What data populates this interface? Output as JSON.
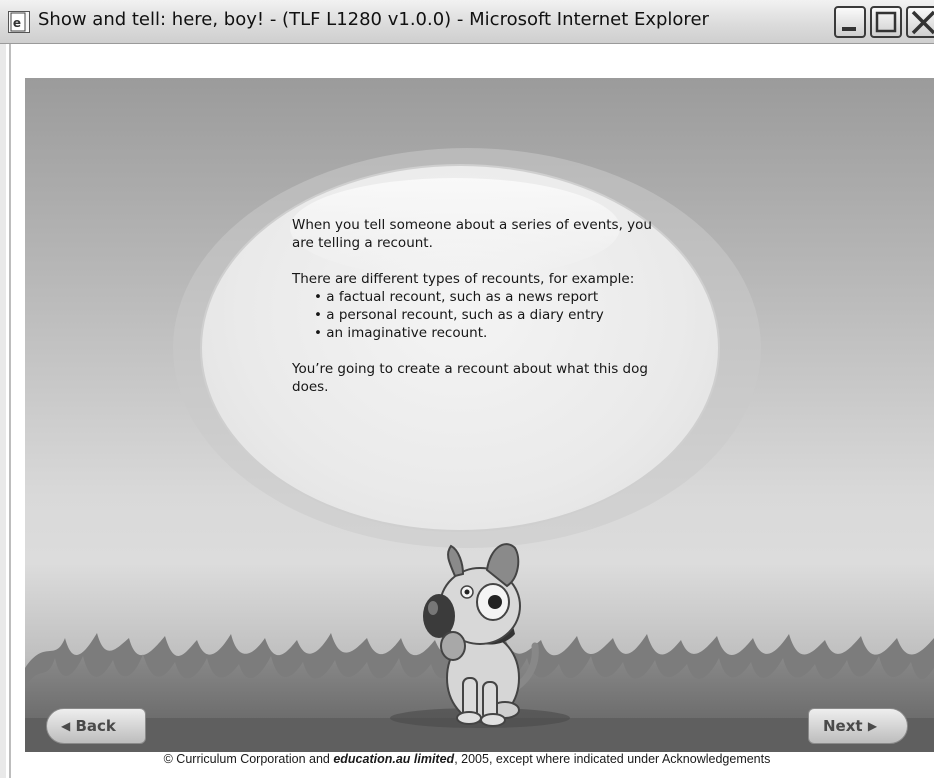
{
  "window": {
    "title": "Show and tell: here, boy! - (TLF L1280 v1.0.0) - Microsoft Internet Explorer",
    "icons": {
      "app": "ie-page-icon",
      "minimize": "minimize-icon",
      "maximize": "maximize-icon",
      "close": "close-icon"
    }
  },
  "bubble": {
    "intro": "When you tell someone about a series of events, you are telling a recount.",
    "types_intro": "There are different types of recounts, for example:",
    "types": [
      "a factual recount, such as a news report",
      "a personal recount, such as a diary entry",
      "an imaginative recount."
    ],
    "closing": "You’re going to create a recount about what this dog does."
  },
  "nav": {
    "back_label": "Back",
    "next_label": "Next",
    "back_icon": "left-arrow-icon",
    "next_icon": "right-arrow-icon"
  },
  "footer": {
    "prefix": "© Curriculum Corporation and ",
    "emphasis": "education.au limited",
    "suffix": ", 2005, except where indicated under Acknowledgements"
  }
}
